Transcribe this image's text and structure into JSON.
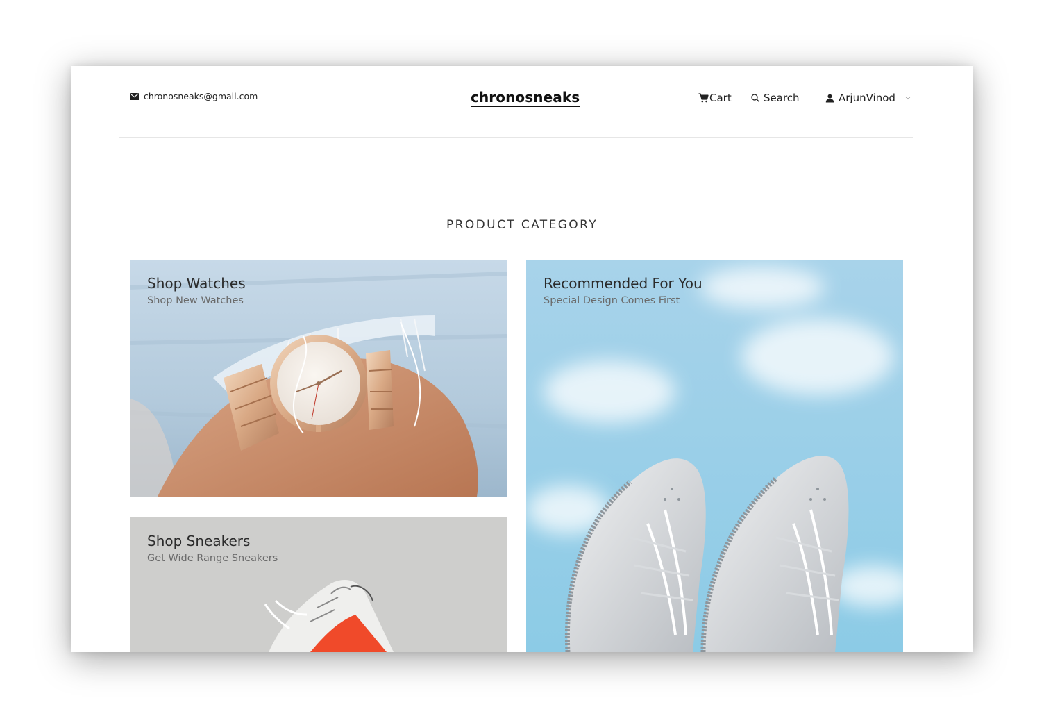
{
  "header": {
    "email": "chronosneaks@gmail.com",
    "email_icon": "mail-icon",
    "logo": "chronosneaks",
    "cart_label": "Cart",
    "cart_icon": "cart-icon",
    "search_label": "Search",
    "search_icon": "search-icon",
    "user_label": "ArjunVinod",
    "user_icon": "user-icon",
    "dropdown_icon": "chevron-down-icon"
  },
  "section": {
    "title": "PRODUCT CATEGORY"
  },
  "cards": [
    {
      "title": "Shop Watches",
      "subtitle": "Shop New Watches"
    },
    {
      "title": "Shop Sneakers",
      "subtitle": "Get Wide Range Sneakers"
    },
    {
      "title": "Recommended For You",
      "subtitle": "Special Design Comes First"
    }
  ],
  "colors": {
    "text": "#222222",
    "subtitle": "#6a6a6a",
    "sky": "#9fd0e8",
    "denim": "#b8cfe0"
  }
}
